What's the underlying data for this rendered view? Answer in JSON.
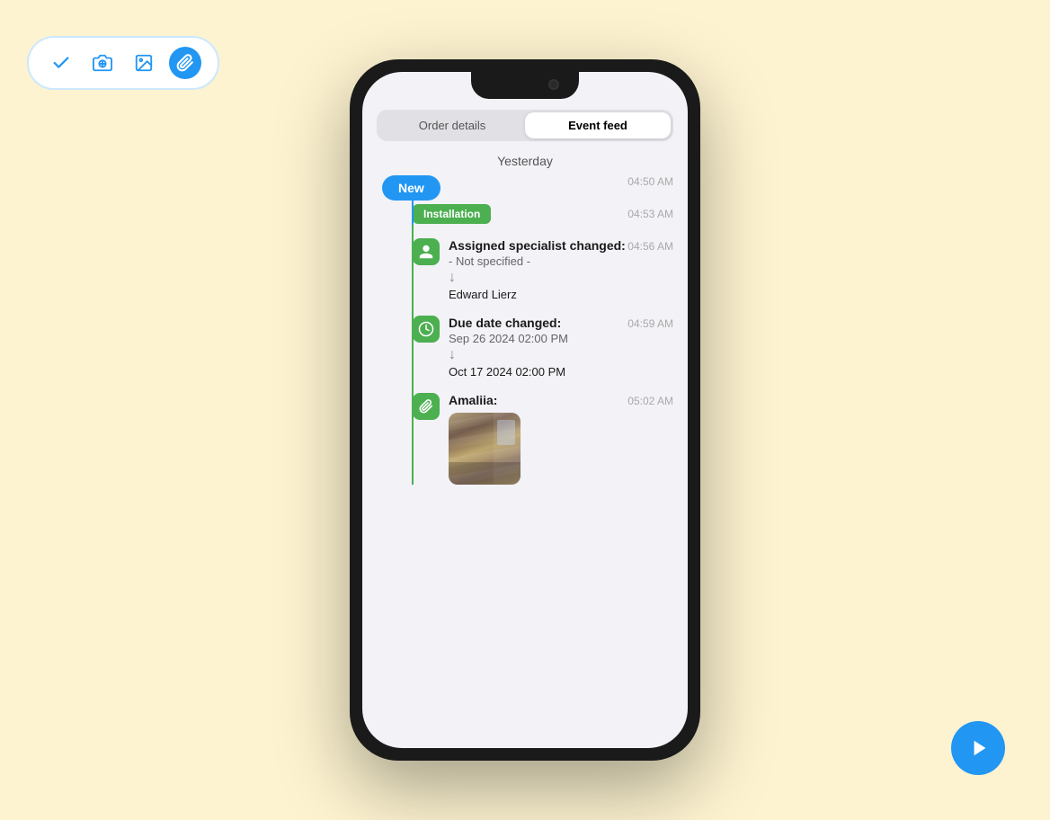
{
  "background": "#fdf3d0",
  "toolbar": {
    "icons": [
      {
        "name": "check-icon",
        "label": "✓",
        "active": false
      },
      {
        "name": "camera-add-icon",
        "label": "📷+",
        "active": false
      },
      {
        "name": "image-icon",
        "label": "🖼",
        "active": false
      },
      {
        "name": "paperclip-icon",
        "label": "📎",
        "active": true
      }
    ]
  },
  "phone": {
    "tabs": [
      {
        "label": "Order details",
        "active": false
      },
      {
        "label": "Event feed",
        "active": true
      }
    ],
    "feed": {
      "date_header": "Yesterday",
      "events": [
        {
          "type": "new_badge",
          "badge_label": "New",
          "time": "04:50 AM"
        },
        {
          "type": "status_tag",
          "tag_label": "Installation",
          "time": "04:53 AM"
        },
        {
          "type": "specialist_change",
          "icon": "person",
          "title": "Assigned specialist changed:",
          "from": "- Not specified -",
          "arrow": "↓",
          "to": "Edward  Lierz",
          "time": "04:56 AM"
        },
        {
          "type": "due_date_change",
          "icon": "clock",
          "title": "Due date changed:",
          "from": "Sep 26 2024 02:00 PM",
          "arrow": "↓",
          "to": "Oct 17 2024 02:00 PM",
          "time": "04:59 AM"
        },
        {
          "type": "attachment",
          "icon": "paperclip",
          "author": "Amaliia:",
          "time": "05:02 AM",
          "has_image": true
        }
      ]
    }
  },
  "play_button": {
    "label": "▶"
  }
}
